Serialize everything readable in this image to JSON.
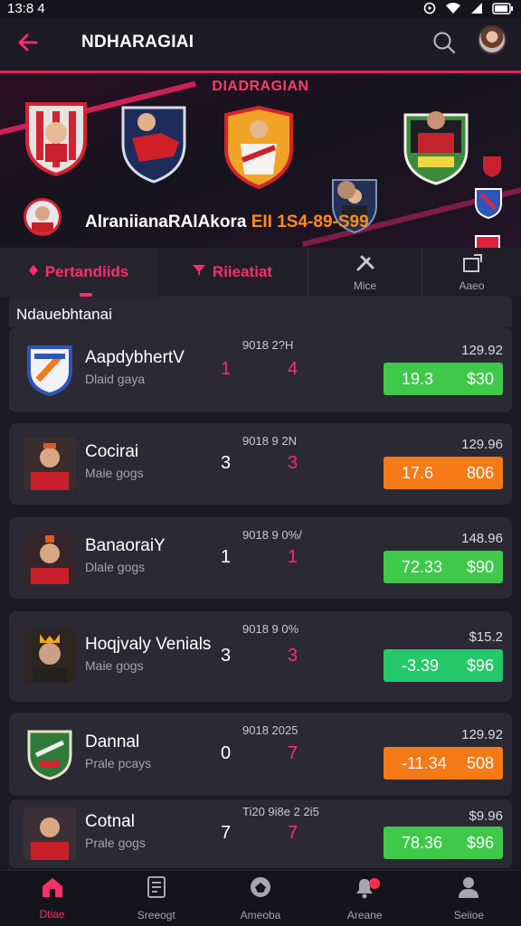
{
  "status": {
    "time": "13:8 4"
  },
  "appbar": {
    "title": "NDHARAGIAI"
  },
  "banner": {
    "title": "DIADRAGIAN",
    "tagline_main": "AlraniianaRAlAkora",
    "tagline_highlight": "EII 1S4-89-S99"
  },
  "tabs": [
    {
      "label": "Pertandiids"
    },
    {
      "label": "Riieatiat"
    },
    {
      "label": "Mice"
    },
    {
      "label": "Aaeo"
    }
  ],
  "section": {
    "title": "Ndauebhtanai"
  },
  "matches": [
    {
      "name": "AapdybhertV",
      "sub": "Dlaid gaya",
      "score_home": "1",
      "score_away": "4",
      "date": "9018 2?H",
      "price": "129.92",
      "odd_a": "19.3",
      "odd_b": "$30",
      "odd_color": "green"
    },
    {
      "name": "Cocirai",
      "sub": "Maie gogs",
      "score_home": "3",
      "score_away": "3",
      "date": "9018 9 2N",
      "price": "129.96",
      "odd_a": "17.6",
      "odd_b": "806",
      "odd_color": "orange"
    },
    {
      "name": "BanaoraiY",
      "sub": "Dlale gogs",
      "score_home": "1",
      "score_away": "1",
      "date": "9018 9 0%/",
      "price": "148.96",
      "odd_a": "72.33",
      "odd_b": "$90",
      "odd_color": "green"
    },
    {
      "name": "Hoqjvaly Venials",
      "sub": "Maie gogs",
      "score_home": "3",
      "score_away": "3",
      "date": "9018 9 0%",
      "price": "$15.2",
      "odd_a": "-3.39",
      "odd_b": "$96",
      "odd_color": "teal"
    },
    {
      "name": "Dannal",
      "sub": "Prale pcays",
      "score_home": "0",
      "score_away": "7",
      "date": "9018 2025",
      "price": "129.92",
      "odd_a": "-11.34",
      "odd_b": "508",
      "odd_color": "orange"
    },
    {
      "name": "Cotnal",
      "sub": "Prale gogs",
      "score_home": "7",
      "score_away": "7",
      "date": "Ti20 9i8e 2 2i5",
      "price": "$9.96",
      "odd_a": "78.36",
      "odd_b": "$96",
      "odd_color": "green"
    }
  ],
  "nav": [
    {
      "label": "Dtiae"
    },
    {
      "label": "Sreeogt"
    },
    {
      "label": "Ameoba"
    },
    {
      "label": "Areane"
    },
    {
      "label": "Seiioe"
    }
  ],
  "colors": {
    "accent": "#ff2d6a",
    "background": "#1b1a22",
    "card": "#2b2a34"
  }
}
